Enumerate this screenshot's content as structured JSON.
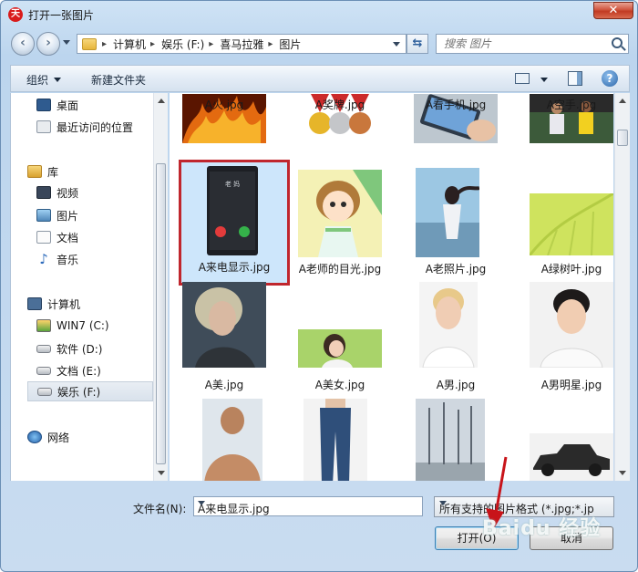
{
  "window": {
    "title": "打开一张图片",
    "app_icon_text": "天"
  },
  "nav": {
    "breadcrumbs": [
      "计算机",
      "娱乐 (F:)",
      "喜马拉雅",
      "图片"
    ],
    "search_placeholder": "搜索 图片"
  },
  "toolbar": {
    "organize_label": "组织",
    "new_folder_label": "新建文件夹"
  },
  "sidebar": {
    "items": [
      {
        "label": "桌面",
        "icon": "desktop-icon"
      },
      {
        "label": "最近访问的位置",
        "icon": "recent-places-icon"
      },
      {
        "label": "库",
        "icon": "library-icon"
      },
      {
        "label": "视频",
        "icon": "video-icon"
      },
      {
        "label": "图片",
        "icon": "pictures-icon"
      },
      {
        "label": "文档",
        "icon": "documents-icon"
      },
      {
        "label": "音乐",
        "icon": "music-icon"
      },
      {
        "label": "计算机",
        "icon": "computer-icon"
      },
      {
        "label": "WIN7 (C:)",
        "icon": "system-drive-icon"
      },
      {
        "label": "软件 (D:)",
        "icon": "drive-icon"
      },
      {
        "label": "文档 (E:)",
        "icon": "drive-icon"
      },
      {
        "label": "娱乐 (F:)",
        "icon": "drive-icon",
        "selected": true
      },
      {
        "label": "网络",
        "icon": "network-icon"
      }
    ]
  },
  "files": [
    {
      "name": "A火.jpg"
    },
    {
      "name": "A奖牌.jpg"
    },
    {
      "name": "A看手机.jpg"
    },
    {
      "name": "A空手.jpg"
    },
    {
      "name": "A来电显示.jpg",
      "selected": true
    },
    {
      "name": "A老师的目光.jpg"
    },
    {
      "name": "A老照片.jpg"
    },
    {
      "name": "A绿树叶.jpg"
    },
    {
      "name": "A美.jpg"
    },
    {
      "name": "A美女.jpg"
    },
    {
      "name": "A男.jpg"
    },
    {
      "name": "A男明星.jpg"
    },
    {
      "name": ""
    },
    {
      "name": ""
    },
    {
      "name": ""
    },
    {
      "name": ""
    }
  ],
  "phone_screen_text": "老 妈",
  "bottom": {
    "filename_label": "文件名(N):",
    "filename_value": "A来电显示.jpg",
    "filetype_value": "所有支持的图片格式 (*.jpg;*.jp",
    "open_label": "打开(O)",
    "cancel_label": "取消"
  },
  "watermark": "Baidu 经验",
  "colors": {
    "selection_outline": "#c0262d",
    "accent": "#3c7fb1"
  }
}
